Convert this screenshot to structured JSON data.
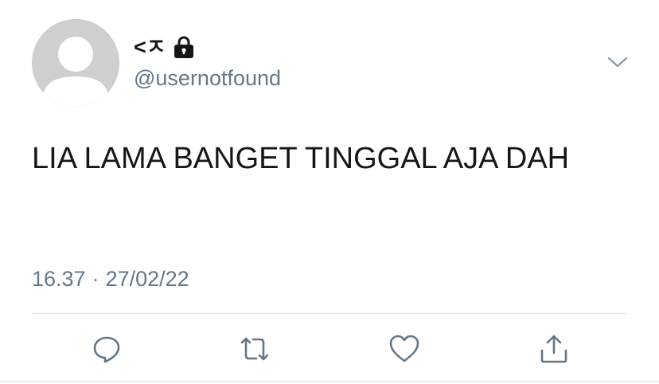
{
  "tweet": {
    "display_name": "<ㅈ",
    "handle": "@usernotfound",
    "text": "LIA LAMA BANGET TINGGAL AJA DAH",
    "time": "16.37",
    "separator": "·",
    "date": "27/02/22"
  },
  "icons": {
    "avatar": "default-avatar",
    "lock": "lock-icon",
    "menu": "chevron-down-icon",
    "reply": "reply-icon",
    "retweet": "retweet-icon",
    "like": "heart-icon",
    "share": "share-icon"
  },
  "colors": {
    "text": "#14171a",
    "secondary": "#657786",
    "icon": "#657786",
    "avatar_bg": "#cfcfcf",
    "divider": "#e1e8ed"
  }
}
